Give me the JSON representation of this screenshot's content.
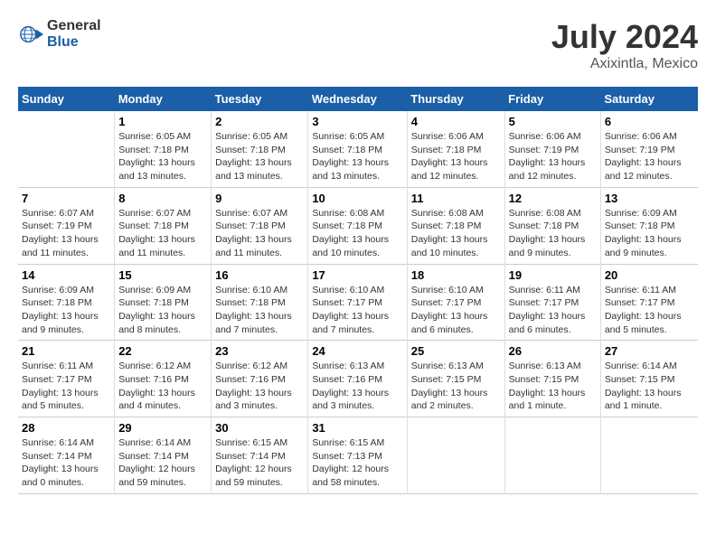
{
  "header": {
    "logo_general": "General",
    "logo_blue": "Blue",
    "month": "July 2024",
    "location": "Axixintla, Mexico"
  },
  "columns": [
    "Sunday",
    "Monday",
    "Tuesday",
    "Wednesday",
    "Thursday",
    "Friday",
    "Saturday"
  ],
  "weeks": [
    [
      {
        "day": "",
        "info": ""
      },
      {
        "day": "1",
        "info": "Sunrise: 6:05 AM\nSunset: 7:18 PM\nDaylight: 13 hours\nand 13 minutes."
      },
      {
        "day": "2",
        "info": "Sunrise: 6:05 AM\nSunset: 7:18 PM\nDaylight: 13 hours\nand 13 minutes."
      },
      {
        "day": "3",
        "info": "Sunrise: 6:05 AM\nSunset: 7:18 PM\nDaylight: 13 hours\nand 13 minutes."
      },
      {
        "day": "4",
        "info": "Sunrise: 6:06 AM\nSunset: 7:18 PM\nDaylight: 13 hours\nand 12 minutes."
      },
      {
        "day": "5",
        "info": "Sunrise: 6:06 AM\nSunset: 7:19 PM\nDaylight: 13 hours\nand 12 minutes."
      },
      {
        "day": "6",
        "info": "Sunrise: 6:06 AM\nSunset: 7:19 PM\nDaylight: 13 hours\nand 12 minutes."
      }
    ],
    [
      {
        "day": "7",
        "info": "Sunrise: 6:07 AM\nSunset: 7:19 PM\nDaylight: 13 hours\nand 11 minutes."
      },
      {
        "day": "8",
        "info": "Sunrise: 6:07 AM\nSunset: 7:18 PM\nDaylight: 13 hours\nand 11 minutes."
      },
      {
        "day": "9",
        "info": "Sunrise: 6:07 AM\nSunset: 7:18 PM\nDaylight: 13 hours\nand 11 minutes."
      },
      {
        "day": "10",
        "info": "Sunrise: 6:08 AM\nSunset: 7:18 PM\nDaylight: 13 hours\nand 10 minutes."
      },
      {
        "day": "11",
        "info": "Sunrise: 6:08 AM\nSunset: 7:18 PM\nDaylight: 13 hours\nand 10 minutes."
      },
      {
        "day": "12",
        "info": "Sunrise: 6:08 AM\nSunset: 7:18 PM\nDaylight: 13 hours\nand 9 minutes."
      },
      {
        "day": "13",
        "info": "Sunrise: 6:09 AM\nSunset: 7:18 PM\nDaylight: 13 hours\nand 9 minutes."
      }
    ],
    [
      {
        "day": "14",
        "info": "Sunrise: 6:09 AM\nSunset: 7:18 PM\nDaylight: 13 hours\nand 9 minutes."
      },
      {
        "day": "15",
        "info": "Sunrise: 6:09 AM\nSunset: 7:18 PM\nDaylight: 13 hours\nand 8 minutes."
      },
      {
        "day": "16",
        "info": "Sunrise: 6:10 AM\nSunset: 7:18 PM\nDaylight: 13 hours\nand 7 minutes."
      },
      {
        "day": "17",
        "info": "Sunrise: 6:10 AM\nSunset: 7:17 PM\nDaylight: 13 hours\nand 7 minutes."
      },
      {
        "day": "18",
        "info": "Sunrise: 6:10 AM\nSunset: 7:17 PM\nDaylight: 13 hours\nand 6 minutes."
      },
      {
        "day": "19",
        "info": "Sunrise: 6:11 AM\nSunset: 7:17 PM\nDaylight: 13 hours\nand 6 minutes."
      },
      {
        "day": "20",
        "info": "Sunrise: 6:11 AM\nSunset: 7:17 PM\nDaylight: 13 hours\nand 5 minutes."
      }
    ],
    [
      {
        "day": "21",
        "info": "Sunrise: 6:11 AM\nSunset: 7:17 PM\nDaylight: 13 hours\nand 5 minutes."
      },
      {
        "day": "22",
        "info": "Sunrise: 6:12 AM\nSunset: 7:16 PM\nDaylight: 13 hours\nand 4 minutes."
      },
      {
        "day": "23",
        "info": "Sunrise: 6:12 AM\nSunset: 7:16 PM\nDaylight: 13 hours\nand 3 minutes."
      },
      {
        "day": "24",
        "info": "Sunrise: 6:13 AM\nSunset: 7:16 PM\nDaylight: 13 hours\nand 3 minutes."
      },
      {
        "day": "25",
        "info": "Sunrise: 6:13 AM\nSunset: 7:15 PM\nDaylight: 13 hours\nand 2 minutes."
      },
      {
        "day": "26",
        "info": "Sunrise: 6:13 AM\nSunset: 7:15 PM\nDaylight: 13 hours\nand 1 minute."
      },
      {
        "day": "27",
        "info": "Sunrise: 6:14 AM\nSunset: 7:15 PM\nDaylight: 13 hours\nand 1 minute."
      }
    ],
    [
      {
        "day": "28",
        "info": "Sunrise: 6:14 AM\nSunset: 7:14 PM\nDaylight: 13 hours\nand 0 minutes."
      },
      {
        "day": "29",
        "info": "Sunrise: 6:14 AM\nSunset: 7:14 PM\nDaylight: 12 hours\nand 59 minutes."
      },
      {
        "day": "30",
        "info": "Sunrise: 6:15 AM\nSunset: 7:14 PM\nDaylight: 12 hours\nand 59 minutes."
      },
      {
        "day": "31",
        "info": "Sunrise: 6:15 AM\nSunset: 7:13 PM\nDaylight: 12 hours\nand 58 minutes."
      },
      {
        "day": "",
        "info": ""
      },
      {
        "day": "",
        "info": ""
      },
      {
        "day": "",
        "info": ""
      }
    ]
  ]
}
